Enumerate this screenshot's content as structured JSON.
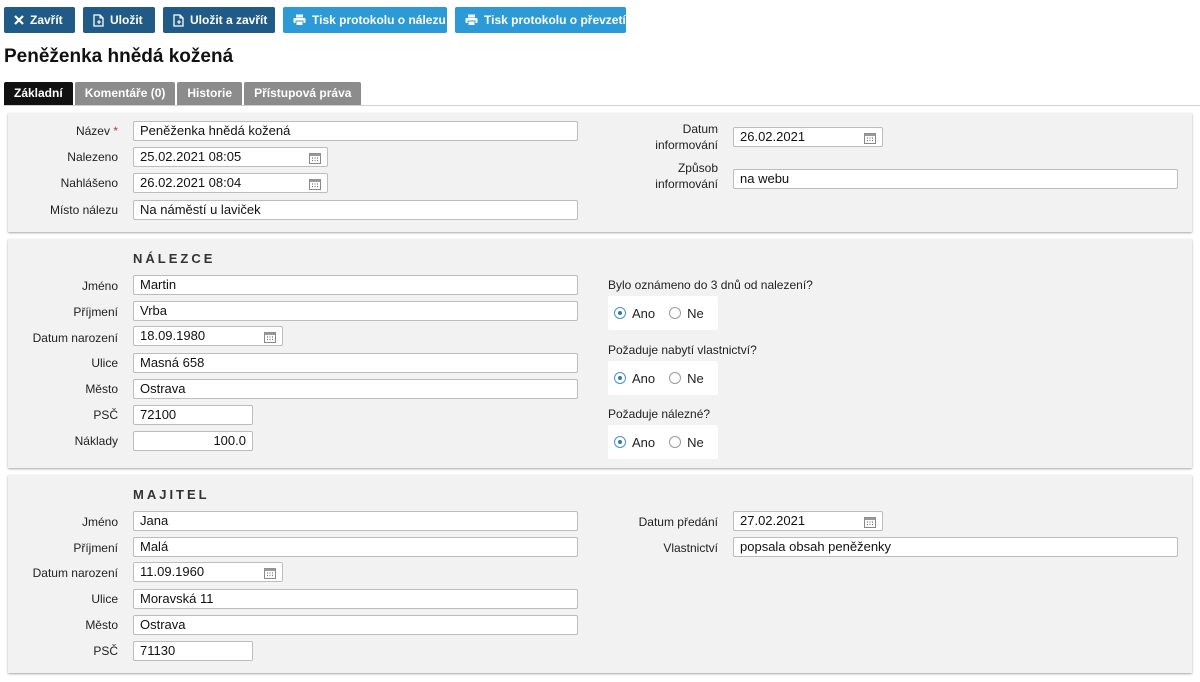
{
  "toolbar": {
    "close_label": "Zavřít",
    "save_label": "Uložit",
    "save_close_label": "Uložit a zavřít",
    "print_found_label": "Tisk protokolu o nálezu",
    "print_handover_label": "Tisk protokolu o převzetí"
  },
  "page_title": "Peněženka hnědá kožená",
  "tabs": [
    "Základní",
    "Komentáře (0)",
    "Historie",
    "Přístupová práva"
  ],
  "basic": {
    "name_label": "Název",
    "required_mark": "*",
    "name_value": "Peněženka hnědá kožená",
    "found_label": "Nalezeno",
    "found_value": "25.02.2021 08:05",
    "reported_label": "Nahlášeno",
    "reported_value": "26.02.2021 08:04",
    "place_label": "Místo nálezu",
    "place_value": "Na náměstí u laviček",
    "info_date_label_1": "Datum",
    "info_date_label_2": "informování",
    "info_date_value": "26.02.2021",
    "info_method_label_1": "Způsob",
    "info_method_label_2": "informování",
    "info_method_value": "na webu"
  },
  "finder": {
    "section_title": "NÁLEZCE",
    "first_name_label": "Jméno",
    "first_name_value": "Martin",
    "last_name_label": "Příjmení",
    "last_name_value": "Vrba",
    "birth_label": "Datum narození",
    "birth_value": "18.09.1980",
    "street_label": "Ulice",
    "street_value": "Masná 658",
    "city_label": "Město",
    "city_value": "Ostrava",
    "zip_label": "PSČ",
    "zip_value": "72100",
    "costs_label": "Náklady",
    "costs_value": "100.0",
    "q1": "Bylo oznámeno do 3 dnů od nalezení?",
    "q2": "Požaduje nabytí vlastnictví?",
    "q3": "Požaduje nálezné?",
    "yes": "Ano",
    "no": "Ne",
    "answers": [
      "Ano",
      "Ano",
      "Ano"
    ]
  },
  "owner": {
    "section_title": "MAJITEL",
    "first_name_label": "Jméno",
    "first_name_value": "Jana",
    "last_name_label": "Příjmení",
    "last_name_value": "Malá",
    "birth_label": "Datum narození",
    "birth_value": "11.09.1960",
    "street_label": "Ulice",
    "street_value": "Moravská 11",
    "city_label": "Město",
    "city_value": "Ostrava",
    "zip_label": "PSČ",
    "zip_value": "71130",
    "handover_label": "Datum předání",
    "handover_value": "27.02.2021",
    "ownership_label": "Vlastnictví",
    "ownership_value": "popsala obsah peněženky"
  },
  "colors": {
    "dark_button": "#1f5b86",
    "light_button": "#2d9ad8",
    "active_tab": "#111111",
    "tab": "#8c8c8c",
    "panel": "#f2f2f2",
    "required": "#c0392b"
  },
  "icons": {
    "close": "close-icon",
    "save": "save-icon",
    "print": "printer-icon",
    "calendar": "calendar-icon"
  }
}
